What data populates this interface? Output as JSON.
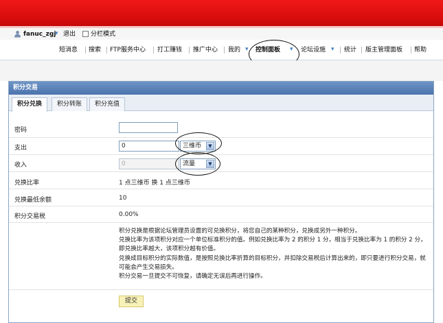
{
  "user_bar": {
    "username": "fanuc_zgj",
    "logout": "退出",
    "split_mode": "分栏模式"
  },
  "nav": {
    "items": [
      "短消息",
      "搜索",
      "FTP服务中心",
      "打工赚钱",
      "推广中心",
      "我的",
      "控制面板",
      "论坛设施",
      "统计",
      "版主管理面板",
      "帮助"
    ]
  },
  "panel": {
    "title": "积分交易",
    "tabs": [
      "积分兑换",
      "积分转账",
      "积分充值"
    ]
  },
  "form": {
    "password_label": "密码",
    "password_value": "",
    "expense_label": "支出",
    "expense_value": "0",
    "expense_currency": "三维币",
    "income_label": "收入",
    "income_value": "0",
    "income_currency": "流量",
    "rate_label": "兑换比率",
    "rate_value": "1 点三维币 换 1 点三维币",
    "min_balance_label": "兑换最低余额",
    "min_balance_value": "10",
    "tax_label": "积分交易税",
    "tax_value": "0.00%",
    "description": [
      "积分兑换是根据论坛管理员设置的可兑换积分，将您自己的某种积分，兑换成另外一种积分。",
      "兑换比率为该项积分对应一个单位标准积分的值。例如兑换比率为 2 的积分 1 分，相当于兑换比率为 1 的积分 2 分，即兑换比率越大，该项积分越有价值。",
      "兑换成目标积分的实际数值，是按照兑换比率折算的目标积分，并扣除交易税后计算出来的，即只要进行积分交易，就可能会产生交易损失。",
      "积分交易一旦提交不可恢复，请确定无误后再进行操作。"
    ],
    "submit_label": "提交"
  },
  "colors": {
    "banner_red": "#e01010",
    "panel_title_blue": "#4a73ad",
    "submit_yellow": "#f8f1b8"
  }
}
